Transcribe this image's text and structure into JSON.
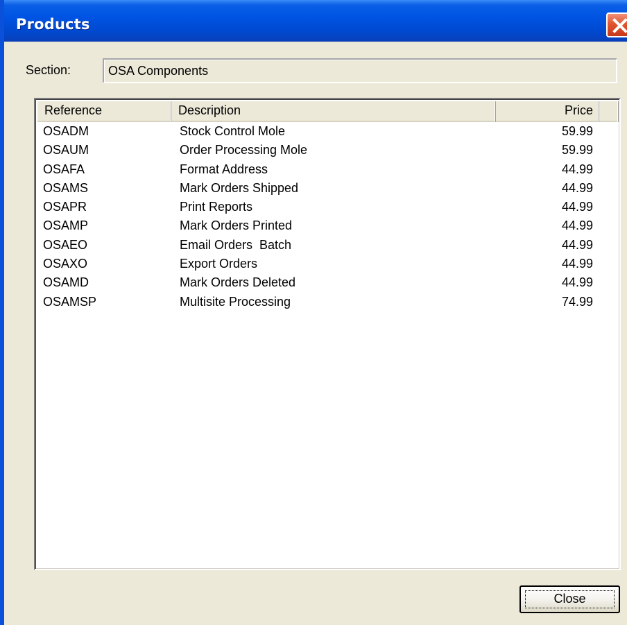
{
  "window": {
    "title": "Products"
  },
  "section": {
    "label": "Section:",
    "value": "OSA Components"
  },
  "table": {
    "columns": [
      "Reference",
      "Description",
      "Price"
    ],
    "rows": [
      {
        "ref": "OSADM",
        "desc": "Stock Control Mole",
        "price": "59.99"
      },
      {
        "ref": "OSAUM",
        "desc": "Order Processing Mole",
        "price": "59.99"
      },
      {
        "ref": "OSAFA",
        "desc": "Format Address",
        "price": "44.99"
      },
      {
        "ref": "OSAMS",
        "desc": "Mark Orders Shipped",
        "price": "44.99"
      },
      {
        "ref": "OSAPR",
        "desc": "Print Reports",
        "price": "44.99"
      },
      {
        "ref": "OSAMP",
        "desc": "Mark Orders Printed",
        "price": "44.99"
      },
      {
        "ref": "OSAEO",
        "desc": "Email Orders  Batch",
        "price": "44.99"
      },
      {
        "ref": "OSAXO",
        "desc": "Export Orders",
        "price": "44.99"
      },
      {
        "ref": "OSAMD",
        "desc": "Mark Orders Deleted",
        "price": "44.99"
      },
      {
        "ref": "OSAMSP",
        "desc": "Multisite Processing",
        "price": "74.99"
      }
    ]
  },
  "buttons": {
    "close_label": "Close"
  },
  "colors": {
    "titlebar": "#0054e3",
    "dialog_face": "#ece9d8",
    "close_x": "#e0562f"
  },
  "icons": {
    "titlebar_close": "close-icon"
  }
}
